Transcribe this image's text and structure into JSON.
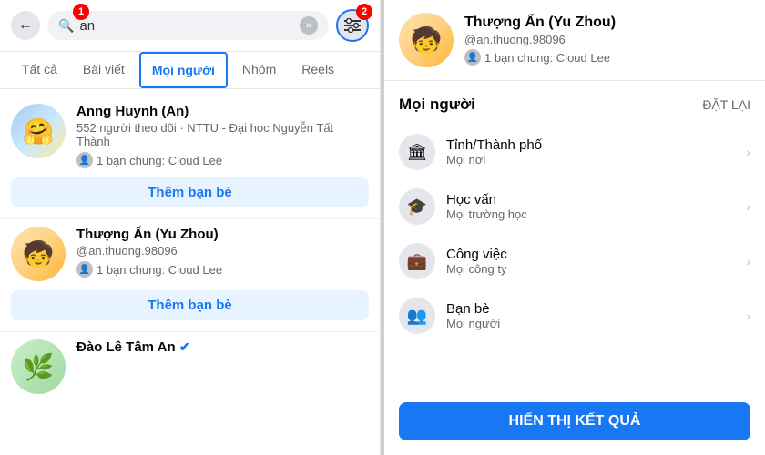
{
  "left": {
    "search_value": "an",
    "clear_button": "×",
    "filter_button": "⚙",
    "back_icon": "←",
    "search_icon": "🔍",
    "annotation_1": "1",
    "annotation_2": "2",
    "tabs": [
      {
        "id": "all",
        "label": "Tất cả",
        "active": false
      },
      {
        "id": "posts",
        "label": "Bài viết",
        "active": false
      },
      {
        "id": "people",
        "label": "Mọi người",
        "active": true
      },
      {
        "id": "groups",
        "label": "Nhóm",
        "active": false
      },
      {
        "id": "reels",
        "label": "Reels",
        "active": false
      }
    ],
    "results": [
      {
        "id": "anng",
        "name": "Anng Huynh (An)",
        "sub": "552 người theo dõi · NTTU - Đại học Nguyễn Tất Thành",
        "mutual": "1 bạn chung: Cloud Lee",
        "add_label": "Thêm bạn bè",
        "emoji": "🤗"
      },
      {
        "id": "thuong",
        "name": "Thượng Ẩn (Yu Zhou)",
        "sub": "@an.thuong.98096",
        "mutual": "1 bạn chung: Cloud Lee",
        "add_label": "Thêm bạn bè",
        "emoji": "🧒"
      },
      {
        "id": "dao",
        "name": "Đào Lê Tâm An",
        "sub": "",
        "mutual": "",
        "add_label": "",
        "emoji": "🌿"
      }
    ]
  },
  "right": {
    "profile": {
      "name": "Thượng Ẩn (Yu Zhou)",
      "handle": "@an.thuong.98096",
      "mutual": "1 bạn chung: Cloud Lee",
      "emoji": "🧒"
    },
    "filter_section": {
      "title": "Mọi người",
      "reset_label": "ĐẶT LẠI",
      "options": [
        {
          "id": "city",
          "icon": "🏛",
          "label": "Tỉnh/Thành phố",
          "value": "Mọi nơi"
        },
        {
          "id": "edu",
          "icon": "🎓",
          "label": "Học vấn",
          "value": "Mọi trường học"
        },
        {
          "id": "work",
          "icon": "💼",
          "label": "Công việc",
          "value": "Mọi công ty"
        },
        {
          "id": "friends",
          "icon": "👥",
          "label": "Bạn bè",
          "value": "Mọi người"
        }
      ]
    },
    "show_results_label": "HIỂN THỊ KẾT QUẢ"
  }
}
